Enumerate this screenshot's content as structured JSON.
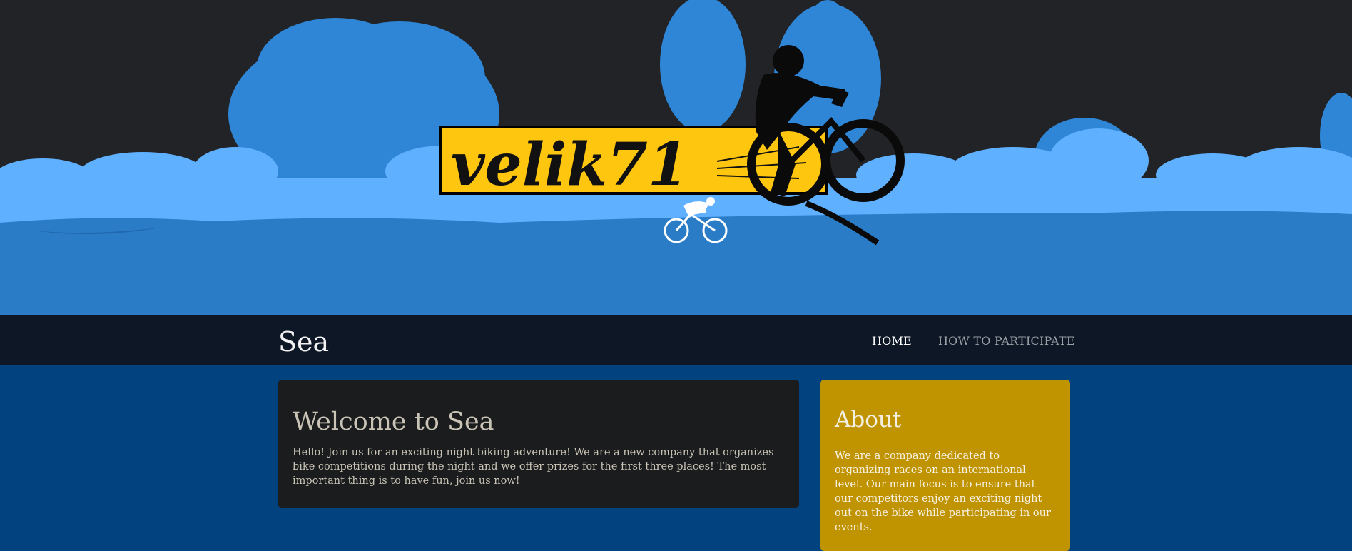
{
  "hero": {
    "logo_text": "velik71",
    "colors": {
      "sky": "#222326",
      "trees_dark": "#2f86d6",
      "trees_light": "#5fb0ff",
      "ground": "#2a7cc7",
      "logo_yellow": "#ffc60f"
    }
  },
  "navbar": {
    "brand": "Sea",
    "links": [
      {
        "label": "HOME",
        "active": true
      },
      {
        "label": "HOW TO PARTICIPATE",
        "active": false
      }
    ]
  },
  "main": {
    "welcome": {
      "title": "Welcome to Sea",
      "text": "Hello! Join us for an exciting night biking adventure! We are a new company that organizes bike competitions during the night and we offer prizes for the first three places! The most important thing is to have fun, join us now!"
    }
  },
  "sidebar": {
    "about": {
      "title": "About",
      "text": "We are a company dedicated to organizing races on an international level. Our main focus is to ensure that our competitors enjoy an exciting night out on the bike while participating in our events."
    }
  }
}
